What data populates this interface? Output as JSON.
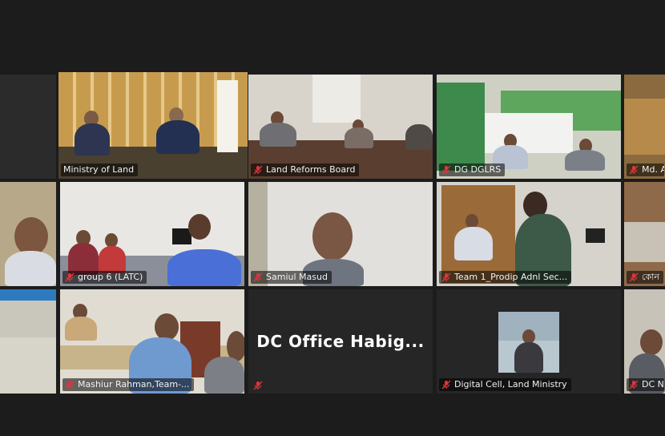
{
  "meeting": {
    "participants": [
      {
        "label": "Ministry of Land",
        "muted": true,
        "active": true
      },
      {
        "label": "Land Reforms Board",
        "muted": true
      },
      {
        "label": "DG DGLRS",
        "muted": true
      },
      {
        "label": "Md. A",
        "muted": true
      },
      {
        "label": "",
        "muted": false
      },
      {
        "label": "group 6 (LATC)",
        "muted": true
      },
      {
        "label": "Samiul Masud",
        "muted": true
      },
      {
        "label": "Team 1_Prodip Adnl Sec...",
        "muted": true
      },
      {
        "label": "কোন",
        "muted": true
      },
      {
        "label": "",
        "muted": false
      },
      {
        "label": "Mashiur Rahman,Team-...",
        "muted": true
      },
      {
        "label": "",
        "muted": true
      },
      {
        "label": "Digital Cell, Land Ministry",
        "muted": true
      },
      {
        "label": "DC N",
        "muted": true
      }
    ],
    "video_off_tile": {
      "display_name": "DC Office Habig..."
    }
  },
  "colors": {
    "background": "#1c1c1c",
    "active_speaker_border": "#d9e86a",
    "muted_mic": "#e0353a"
  },
  "icons": {
    "mic": "mic-muted-icon"
  }
}
